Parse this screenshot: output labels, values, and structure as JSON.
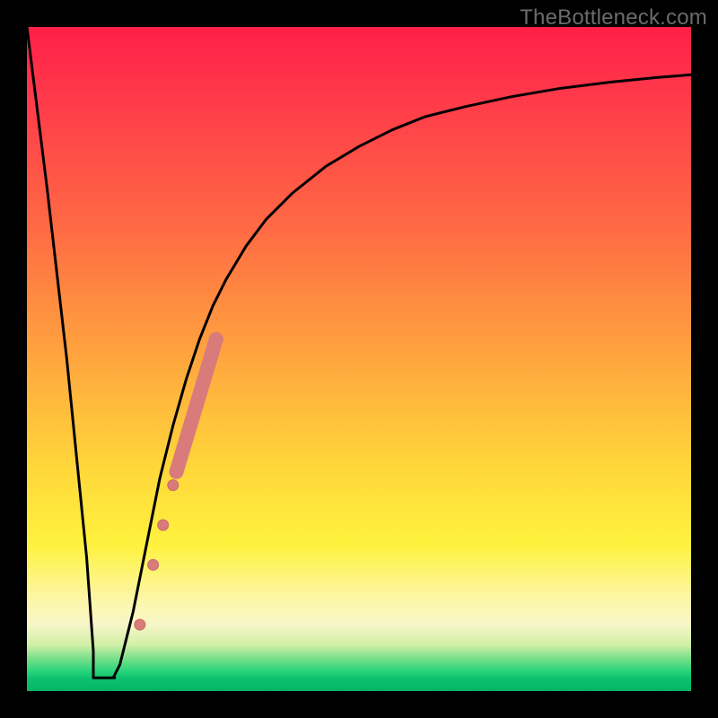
{
  "watermark": "TheBottleneck.com",
  "colors": {
    "curve_stroke": "#000000",
    "marker_fill": "#d97b7b",
    "marker_stroke": "#c96b6b",
    "frame_bg": "#000000"
  },
  "chart_data": {
    "type": "line",
    "title": "",
    "xlabel": "",
    "ylabel": "",
    "xlim": [
      0,
      100
    ],
    "ylim": [
      0,
      100
    ],
    "grid": false,
    "legend": false,
    "note": "Axes are unlabeled; values are relative estimates (0–100 each axis) read from pixel positions.",
    "series": [
      {
        "name": "bottleneck-curve",
        "x": [
          0,
          3,
          6,
          9,
          10,
          11,
          12,
          13,
          14,
          16,
          18,
          20,
          22,
          24,
          26,
          28,
          30,
          33,
          36,
          40,
          45,
          50,
          55,
          60,
          66,
          73,
          80,
          88,
          95,
          100
        ],
        "y": [
          100,
          76,
          50,
          20,
          6,
          2,
          2,
          2,
          4,
          12,
          22,
          32,
          40,
          47,
          53,
          58,
          62,
          67,
          71,
          75,
          79,
          82,
          84.5,
          86.5,
          88,
          89.5,
          90.7,
          91.7,
          92.4,
          92.8
        ]
      }
    ],
    "flat_bottom": {
      "x_start": 10,
      "x_end": 13.2,
      "y": 2
    },
    "markers": {
      "name": "highlighted-points",
      "shape": "circle",
      "points": [
        {
          "x": 17.0,
          "y": 10.0,
          "r": 6
        },
        {
          "x": 19.0,
          "y": 19.0,
          "r": 6
        },
        {
          "x": 20.5,
          "y": 25.0,
          "r": 6
        },
        {
          "x": 22.0,
          "y": 31.0,
          "r": 6
        }
      ],
      "thick_segment": {
        "x_start": 22.5,
        "x_end": 28.5,
        "y_start": 33,
        "y_end": 53
      }
    }
  }
}
